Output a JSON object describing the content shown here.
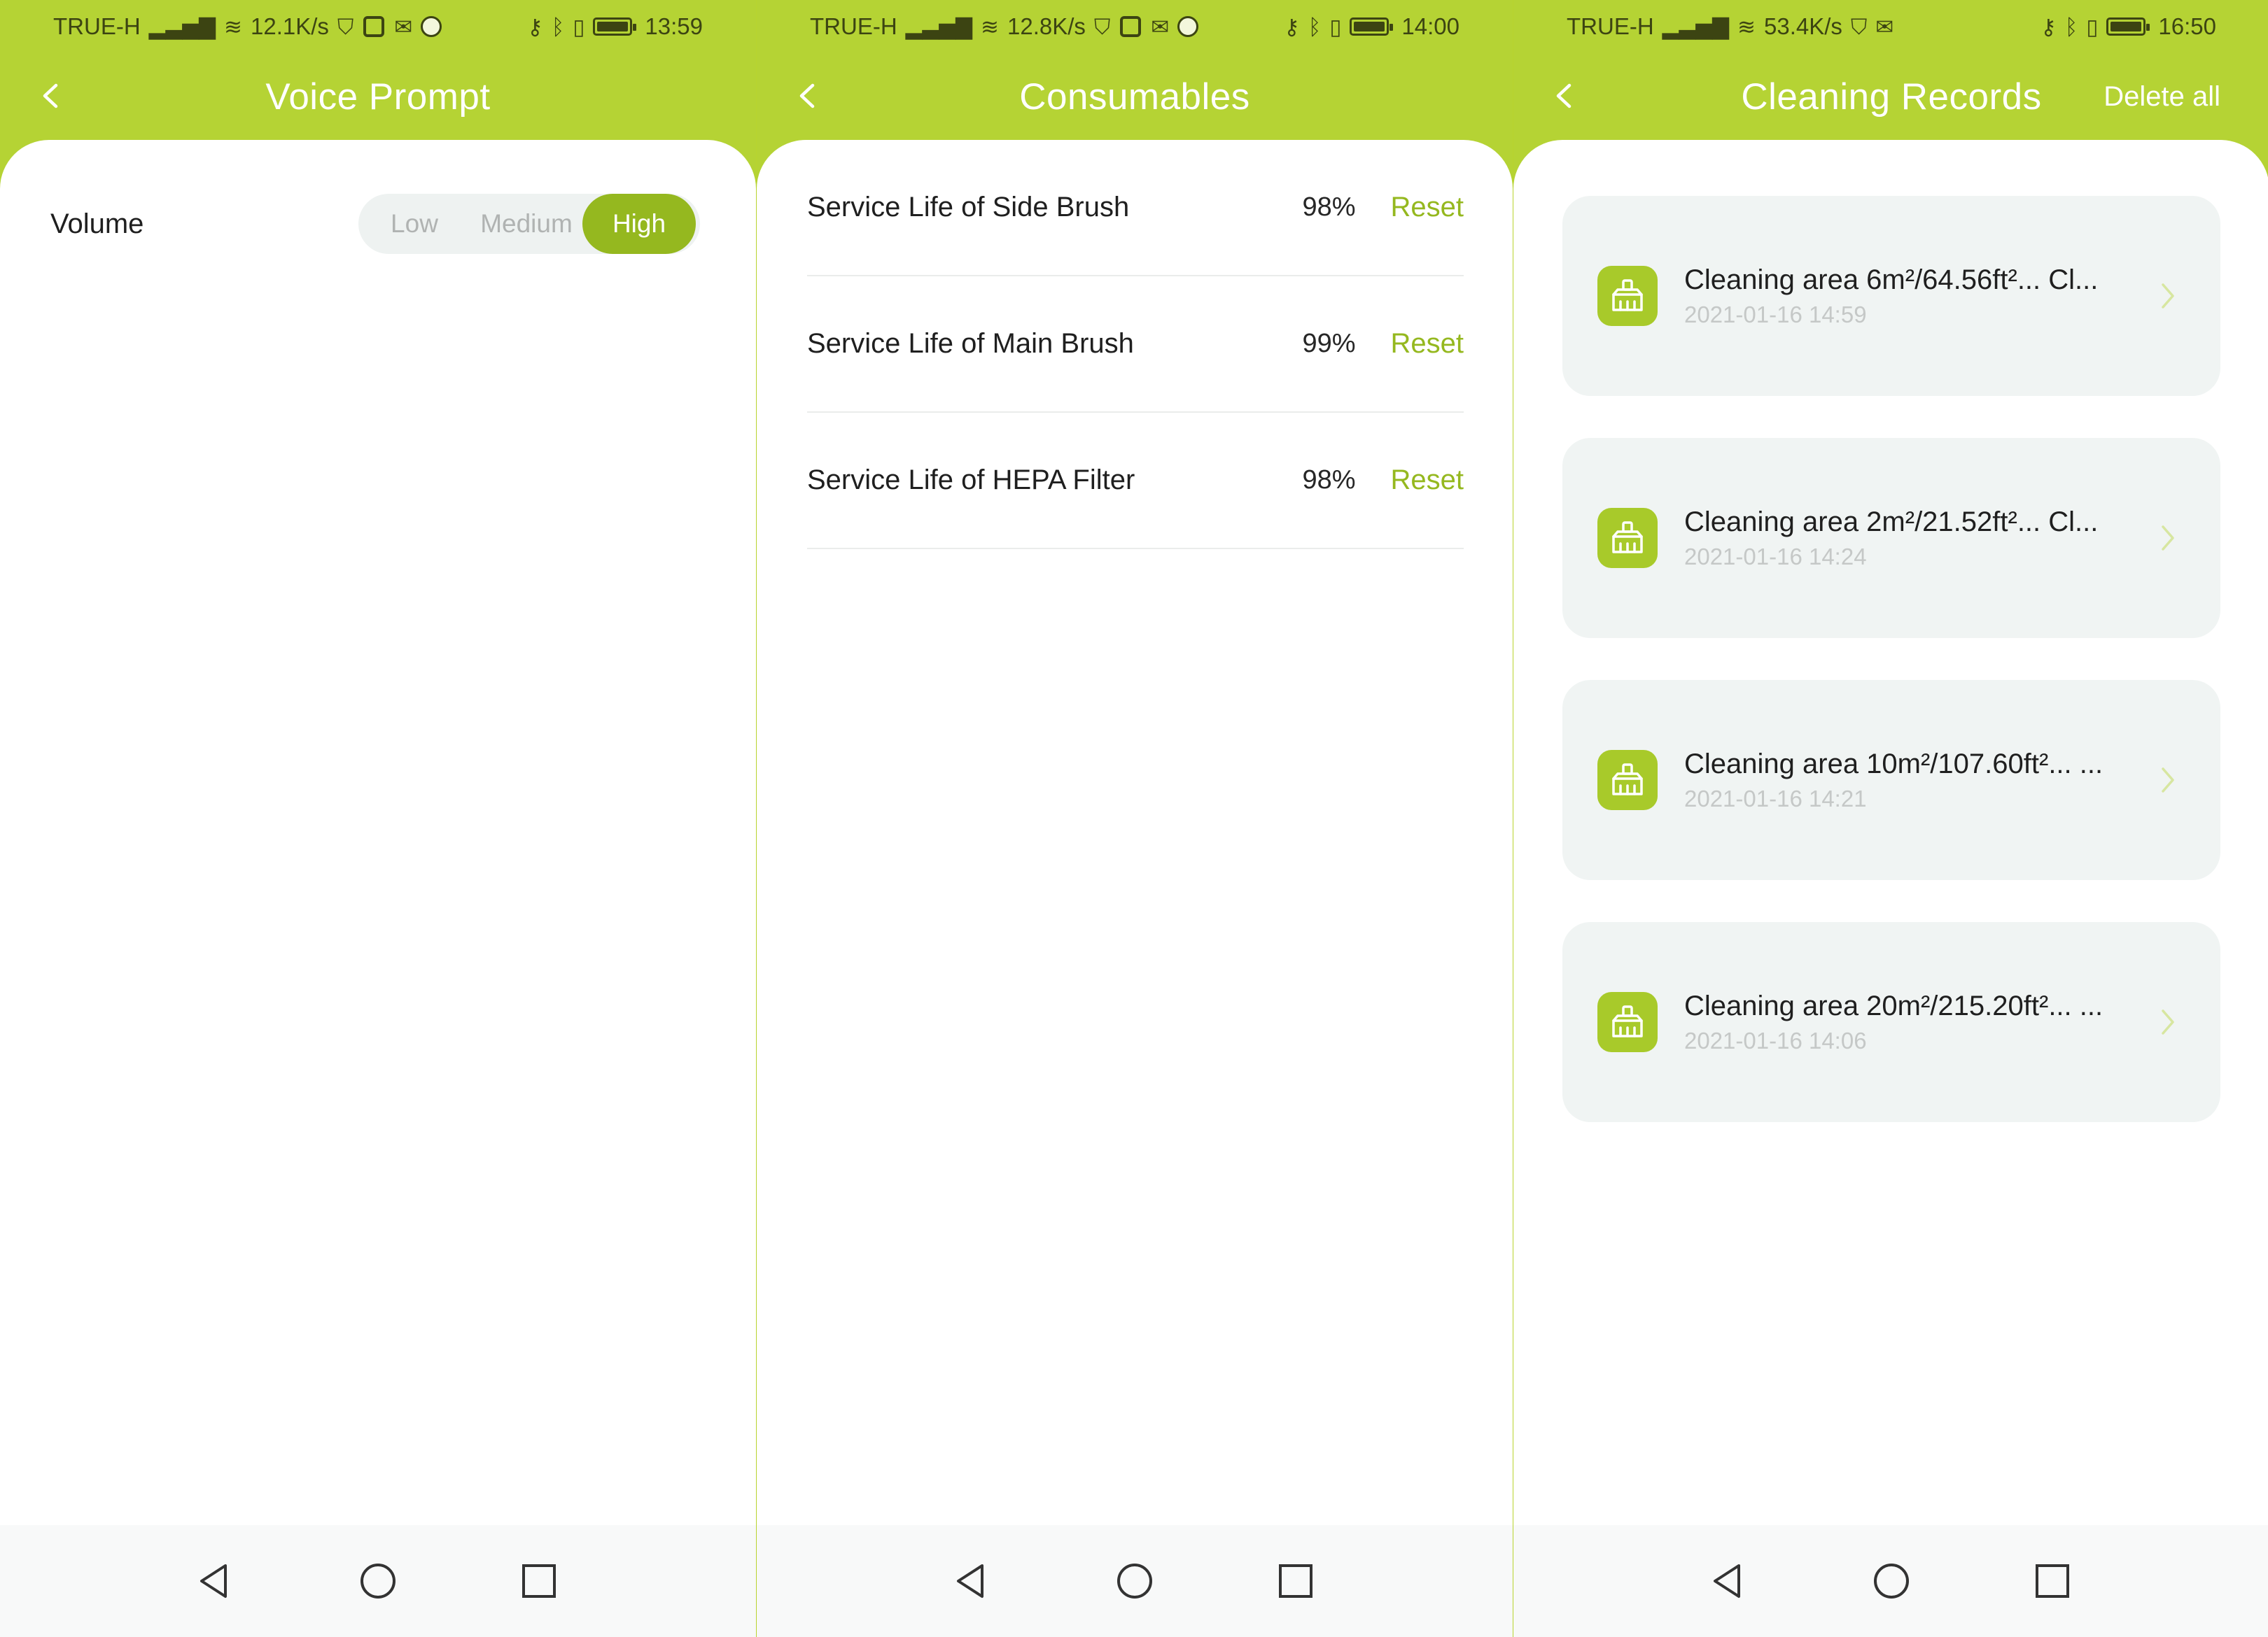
{
  "panels": [
    {
      "status": {
        "carrier": "TRUE-H",
        "speed": "12.1K/s",
        "time": "13:59"
      },
      "title": "Voice Prompt",
      "volume": {
        "label": "Volume",
        "options": [
          "Low",
          "Medium",
          "High"
        ],
        "selected": "High"
      }
    },
    {
      "status": {
        "carrier": "TRUE-H",
        "speed": "12.8K/s",
        "time": "14:00"
      },
      "title": "Consumables",
      "items": [
        {
          "name": "Service Life of Side Brush",
          "percent": "98%",
          "action": "Reset"
        },
        {
          "name": "Service Life of Main Brush",
          "percent": "99%",
          "action": "Reset"
        },
        {
          "name": "Service Life of HEPA Filter",
          "percent": "98%",
          "action": "Reset"
        }
      ]
    },
    {
      "status": {
        "carrier": "TRUE-H",
        "speed": "53.4K/s",
        "time": "16:50"
      },
      "title": "Cleaning Records",
      "action": "Delete all",
      "records": [
        {
          "title": "Cleaning area 6m²/64.56ft²...  Cl...",
          "date": "2021-01-16 14:59"
        },
        {
          "title": "Cleaning area 2m²/21.52ft²...  Cl...",
          "date": "2021-01-16 14:24"
        },
        {
          "title": "Cleaning area 10m²/107.60ft²...  ...",
          "date": "2021-01-16 14:21"
        },
        {
          "title": "Cleaning area 20m²/215.20ft²...  ...",
          "date": "2021-01-16 14:06"
        }
      ]
    }
  ],
  "theme": {
    "accent": "#b5d334",
    "accent_dark": "#95b81f"
  }
}
